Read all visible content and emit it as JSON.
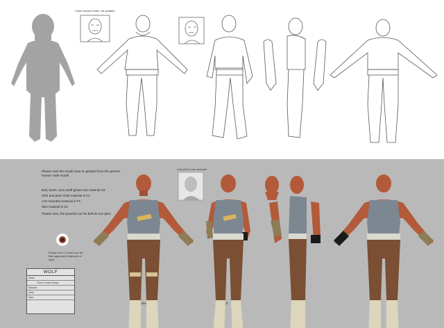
{
  "top_sheet": {
    "headshot_caption": "Clone trooper head, not updated"
  },
  "bottom_sheet": {
    "note_mouth": "Please note the mouth area is updated from the generic human male mouth",
    "headshot_caption": "Included in turn arounds",
    "materials": [
      "Belt, boots, and cutoff gloves are material C5",
      "Shirt and pant Cloth material is C1",
      "Arm Gauntlet material is P1",
      "Skin material is S1"
    ],
    "note_pouches": "Please note, the pouches on his belt do not open",
    "eye_caption": "Please see C1 Eyes use for final approved treatment of eyes",
    "view_labels": {
      "hero": "Hero View",
      "spot": "Spot Of"
    }
  },
  "title_block": {
    "name": "WOLF",
    "rows": [
      {
        "label": "Asset:",
        "value": ""
      },
      {
        "label": "",
        "value": "Clone Trooper Gregor"
      },
      {
        "label": "Episode:",
        "value": ""
      },
      {
        "label": "Artist:",
        "value": ""
      },
      {
        "label": "Date:",
        "value": ""
      },
      {
        "label": "",
        "value": ""
      }
    ]
  },
  "colors": {
    "skin": "#b35a3a",
    "tank_top": "#7d8791",
    "pants": "#7a4f33",
    "boots": "#ddd6bd",
    "gauntlet": "#8d7d55",
    "belt": "#d9d9cf",
    "silhouette": "#a3a3a3",
    "sheet_bg": "#b9b9b9"
  }
}
